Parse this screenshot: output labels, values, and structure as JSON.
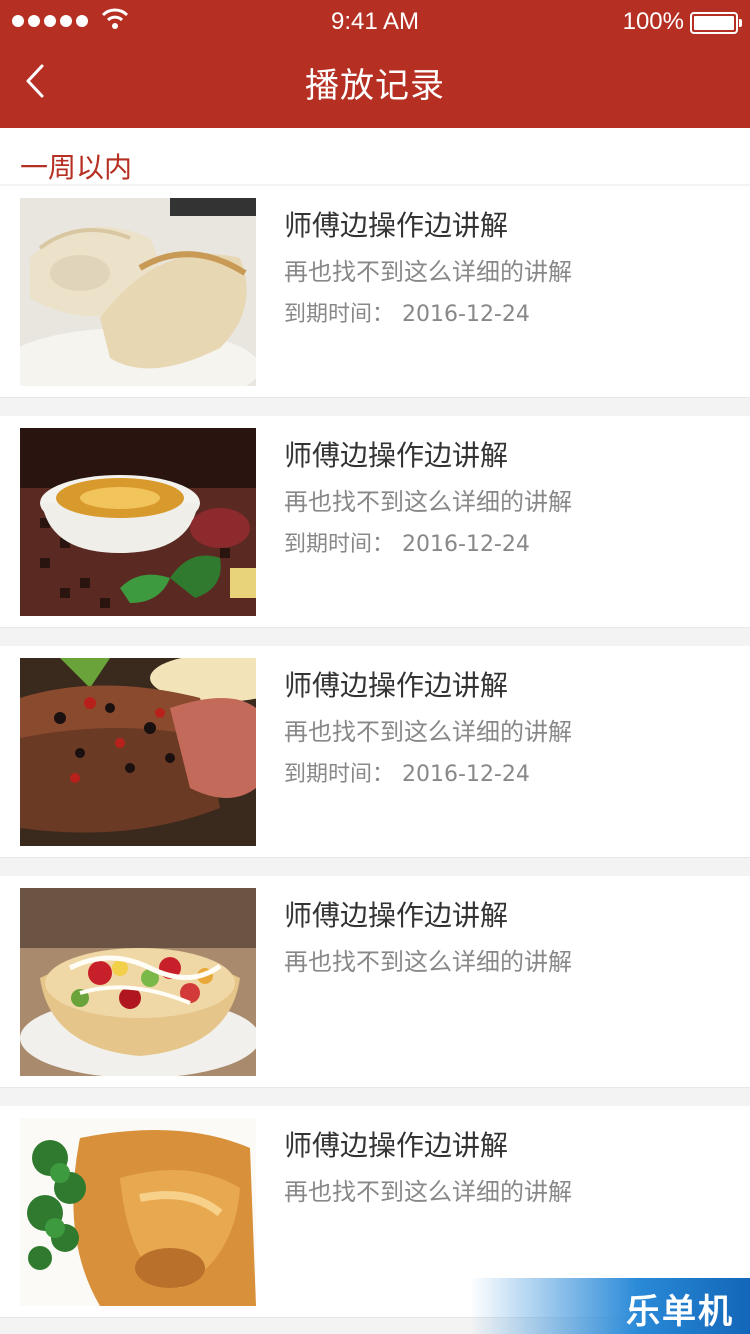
{
  "status_bar": {
    "time": "9:41 AM",
    "battery": "100%"
  },
  "header": {
    "title": "播放记录",
    "back_icon": "chevron-left-icon"
  },
  "section": {
    "label": "一周以内"
  },
  "items": [
    {
      "title": "师傅边操作边讲解",
      "subtitle": "再也找不到这么详细的讲解",
      "expire_label": "到期时间：",
      "expire_date": "2016-12-24",
      "image": "dumplings"
    },
    {
      "title": "师傅边操作边讲解",
      "subtitle": "再也找不到这么详细的讲解",
      "expire_label": "到期时间：",
      "expire_date": "2016-12-24",
      "image": "soup-pot"
    },
    {
      "title": "师傅边操作边讲解",
      "subtitle": "再也找不到这么详细的讲解",
      "expire_label": "到期时间：",
      "expire_date": "2016-12-24",
      "image": "steak"
    },
    {
      "title": "师傅边操作边讲解",
      "subtitle": "再也找不到这么详细的讲解",
      "image": "fruit-salad"
    },
    {
      "title": "师傅边操作边讲解",
      "subtitle": "再也找不到这么详细的讲解",
      "image": "braised-trotter"
    }
  ],
  "watermark": {
    "text": "乐单机"
  },
  "colors": {
    "brand": "#b53023",
    "text": "#333333",
    "muted": "#888888"
  }
}
